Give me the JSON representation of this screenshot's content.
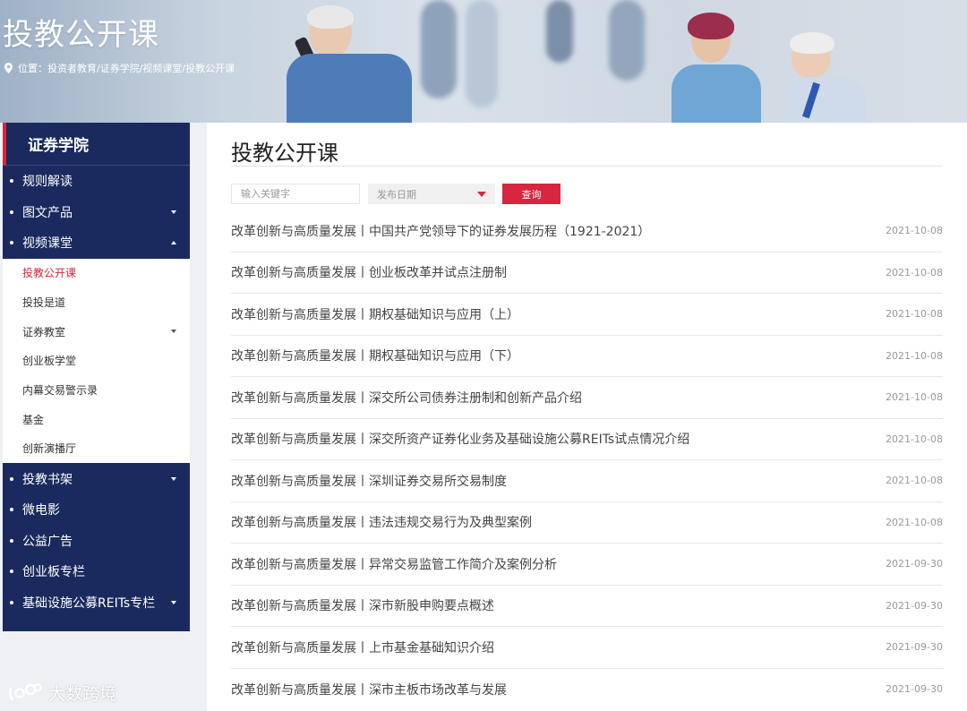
{
  "banner": {
    "title": "投教公开课",
    "breadcrumb": "位置：投资者教育/证券学院/视频课堂/投教公开课"
  },
  "sidebar": {
    "header": "证券学院",
    "nav": [
      {
        "label": "规则解读"
      },
      {
        "label": "图文产品",
        "caret": "down"
      },
      {
        "label": "视频课堂",
        "caret": "up"
      }
    ],
    "sub": [
      {
        "label": "投教公开课",
        "active": true
      },
      {
        "label": "投投是道"
      },
      {
        "label": "证券教室",
        "caret": "down"
      },
      {
        "label": "创业板学堂"
      },
      {
        "label": "内幕交易警示录"
      },
      {
        "label": "基金"
      },
      {
        "label": "创新演播厅"
      }
    ],
    "nav_after": [
      {
        "label": "投教书架",
        "caret": "down"
      },
      {
        "label": "微电影"
      },
      {
        "label": "公益广告"
      },
      {
        "label": "创业板专栏"
      },
      {
        "label": "基础设施公募REITs专栏",
        "caret": "down"
      }
    ]
  },
  "main": {
    "title": "投教公开课",
    "search": {
      "placeholder": "输入关键字",
      "date_placeholder": "发布日期",
      "button": "查询"
    },
    "items": [
      {
        "title": "改革创新与高质量发展丨中国共产党领导下的证券发展历程（1921-2021）",
        "date": "2021-10-08"
      },
      {
        "title": "改革创新与高质量发展丨创业板改革并试点注册制",
        "date": "2021-10-08"
      },
      {
        "title": "改革创新与高质量发展丨期权基础知识与应用（上）",
        "date": "2021-10-08"
      },
      {
        "title": "改革创新与高质量发展丨期权基础知识与应用（下）",
        "date": "2021-10-08"
      },
      {
        "title": "改革创新与高质量发展丨深交所公司债券注册制和创新产品介绍",
        "date": "2021-10-08"
      },
      {
        "title": "改革创新与高质量发展丨深交所资产证券化业务及基础设施公募REITs试点情况介绍",
        "date": "2021-10-08"
      },
      {
        "title": "改革创新与高质量发展丨深圳证券交易所交易制度",
        "date": "2021-10-08"
      },
      {
        "title": "改革创新与高质量发展丨违法违规交易行为及典型案例",
        "date": "2021-10-08"
      },
      {
        "title": "改革创新与高质量发展丨异常交易监管工作简介及案例分析",
        "date": "2021-09-30"
      },
      {
        "title": "改革创新与高质量发展丨深市新股申购要点概述",
        "date": "2021-09-30"
      },
      {
        "title": "改革创新与高质量发展丨上市基金基础知识介绍",
        "date": "2021-09-30"
      },
      {
        "title": "改革创新与高质量发展丨深市主板市场改革与发展",
        "date": "2021-09-30"
      }
    ]
  },
  "watermark": "大数跨境",
  "colors": {
    "navy": "#1b2a5e",
    "accent_red": "#d7263d",
    "active_text": "#d7263d"
  }
}
